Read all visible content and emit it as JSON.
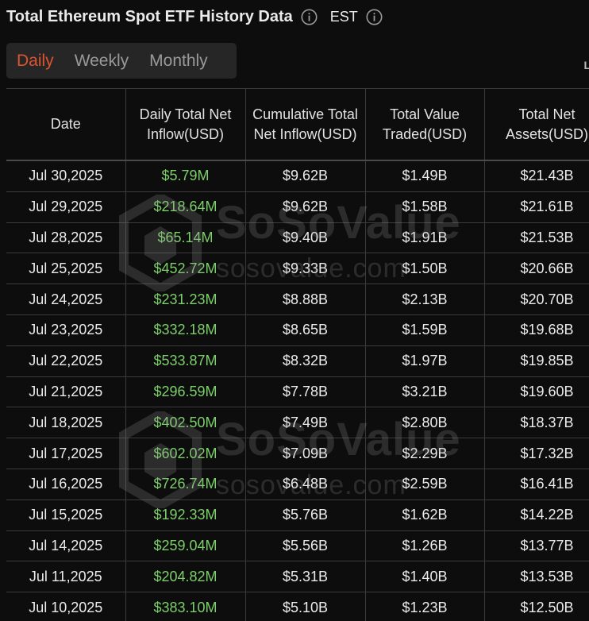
{
  "header": {
    "title": "Total Ethereum Spot ETF History Data",
    "timezone": "EST",
    "icons": [
      "info-icon",
      "info-icon"
    ]
  },
  "tabs": [
    {
      "label": "Daily",
      "active": true
    },
    {
      "label": "Weekly",
      "active": false
    },
    {
      "label": "Monthly",
      "active": false
    }
  ],
  "corner_mark": "L",
  "watermark": {
    "brand": "SoSoValue",
    "url": "sosovalue.com",
    "icon": "sosovalue-logo-icon"
  },
  "colors": {
    "accent": "#e0532f",
    "positive": "#7ccf6a",
    "background": "#0d0d0d"
  },
  "table": {
    "columns": [
      "Date",
      "Daily Total Net Inflow(USD)",
      "Cumulative Total Net Inflow(USD)",
      "Total Value Traded(USD)",
      "Total Net Assets(USD)"
    ],
    "rows": [
      [
        "Jul 30,2025",
        "$5.79M",
        "$9.62B",
        "$1.49B",
        "$21.43B"
      ],
      [
        "Jul 29,2025",
        "$218.64M",
        "$9.62B",
        "$1.58B",
        "$21.61B"
      ],
      [
        "Jul 28,2025",
        "$65.14M",
        "$9.40B",
        "$1.91B",
        "$21.53B"
      ],
      [
        "Jul 25,2025",
        "$452.72M",
        "$9.33B",
        "$1.50B",
        "$20.66B"
      ],
      [
        "Jul 24,2025",
        "$231.23M",
        "$8.88B",
        "$2.13B",
        "$20.70B"
      ],
      [
        "Jul 23,2025",
        "$332.18M",
        "$8.65B",
        "$1.59B",
        "$19.68B"
      ],
      [
        "Jul 22,2025",
        "$533.87M",
        "$8.32B",
        "$1.97B",
        "$19.85B"
      ],
      [
        "Jul 21,2025",
        "$296.59M",
        "$7.78B",
        "$3.21B",
        "$19.60B"
      ],
      [
        "Jul 18,2025",
        "$402.50M",
        "$7.49B",
        "$2.80B",
        "$18.37B"
      ],
      [
        "Jul 17,2025",
        "$602.02M",
        "$7.09B",
        "$2.29B",
        "$17.32B"
      ],
      [
        "Jul 16,2025",
        "$726.74M",
        "$6.48B",
        "$2.59B",
        "$16.41B"
      ],
      [
        "Jul 15,2025",
        "$192.33M",
        "$5.76B",
        "$1.62B",
        "$14.22B"
      ],
      [
        "Jul 14,2025",
        "$259.04M",
        "$5.56B",
        "$1.26B",
        "$13.77B"
      ],
      [
        "Jul 11,2025",
        "$204.82M",
        "$5.31B",
        "$1.40B",
        "$13.53B"
      ],
      [
        "Jul 10,2025",
        "$383.10M",
        "$5.10B",
        "$1.23B",
        "$12.50B"
      ]
    ]
  }
}
